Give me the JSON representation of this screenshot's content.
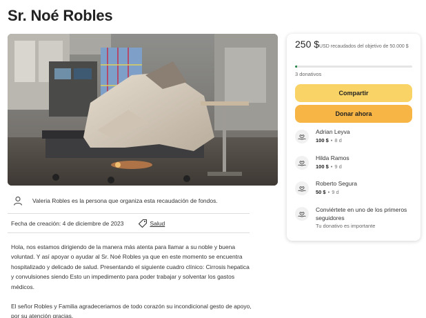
{
  "page": {
    "title": "Sr. Noé Robles"
  },
  "organizer": {
    "text": "Valeria Robles es la persona que organiza esta recaudación de fondos."
  },
  "meta": {
    "created": "Fecha de creación: 4 de diciembre de 2023",
    "category": "Salud"
  },
  "story": {
    "p1": "Hola, nos estamos dirigiendo de la manera más atenta para llamar a su noble y buena voluntad. Y así apoyar o ayudar al Sr. Noé Robles ya que en este momento se encuentra hospitalizado y delicado de salud. Presentando el siguiente cuadro clínico: Cirrosis hepatica y convulsiones siendo Esto un impedimento para poder trabajar y solventar los gastos médicos.",
    "p2": "El señor Robles y Familia agradeceriamos de todo corazón su incondicional gesto de apoyo, por su atención gracias."
  },
  "donation": {
    "raised": "250 $",
    "raised_sub": "USD recaudados del objetivo de 50.000 $",
    "progress_fraction": 0.005,
    "count": "3 donativos",
    "share_label": "Compartir",
    "donate_label": "Donar ahora",
    "donors": [
      {
        "name": "Adrian Leyva",
        "amount": "100 $",
        "time": "8 d"
      },
      {
        "name": "Hilda Ramos",
        "amount": "100 $",
        "time": "9 d"
      },
      {
        "name": "Roberto Segura",
        "amount": "50 $",
        "time": "9 d"
      }
    ],
    "cta_title": "Conviértete en uno de los primeros seguidores",
    "cta_sub": "Tu donativo es importante"
  },
  "colors": {
    "share_button": "#f9d365",
    "donate_button": "#f7b545",
    "progress": "#2d8a4e"
  },
  "icons": {
    "organizer": "person-icon",
    "category": "tag-icon",
    "donor": "heart-hand-icon"
  }
}
